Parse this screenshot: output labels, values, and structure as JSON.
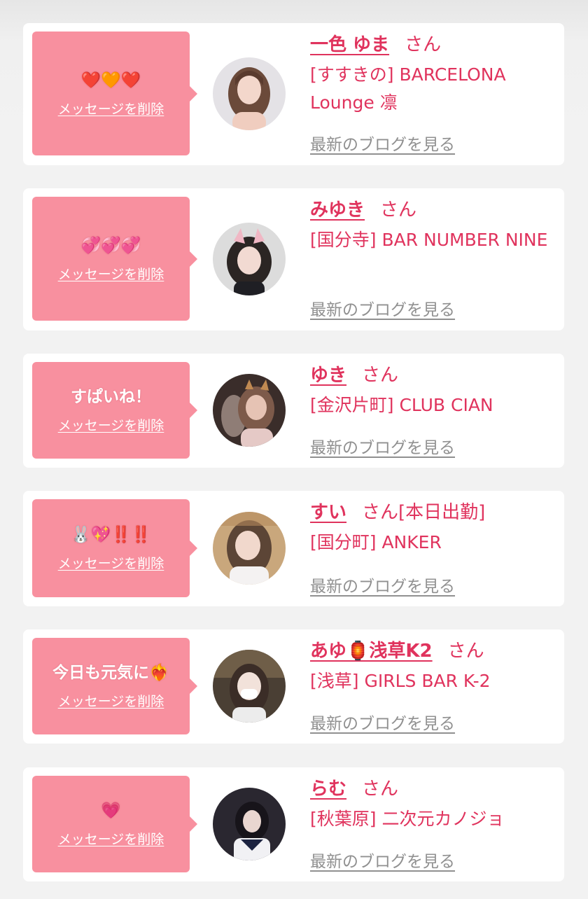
{
  "colors": {
    "accent": "#e0335d",
    "bubble": "#f8909f",
    "muted": "#909090",
    "background": "#f2f2f2"
  },
  "delete_label": "メッセージを削除",
  "san_label": "さん",
  "blog_label": "最新のブログを見る",
  "entries": [
    {
      "message": "❤️🧡❤️",
      "name": "一色 ゆま",
      "badge": "",
      "shop": "[すすきの] BARCELONA Lounge 凛"
    },
    {
      "message": "💞💞💞",
      "name": "みゆき",
      "badge": "",
      "shop": "[国分寺] BAR NUMBER NINE"
    },
    {
      "message": "すぱいね！",
      "name": "ゆき",
      "badge": "",
      "shop": "[金沢片町] CLUB CIAN"
    },
    {
      "message": "🐰💖‼️‼️",
      "name": "すい",
      "badge": "[本日出勤]",
      "shop": "[国分町] ANKER"
    },
    {
      "message": "今日も元気に❤️‍🔥",
      "name": "あゆ🏮浅草K2",
      "badge": "",
      "shop": "[浅草] GIRLS BAR K-2"
    },
    {
      "message": "💗",
      "name": "らむ",
      "badge": "",
      "shop": "[秋葉原] 二次元カノジョ"
    }
  ]
}
